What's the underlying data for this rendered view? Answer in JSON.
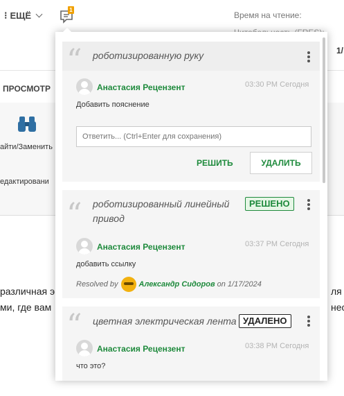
{
  "app": {
    "more_label": "ЕЩЁ",
    "comment_count": "1",
    "reading_time_label": "Время на чтение:",
    "readability_label": "Читабельность (FRES):",
    "right_fragment": "1/",
    "tab_review": "ПРОСМОТР",
    "find_replace_label": "айти/Заменить",
    "edit_label": "едактировани",
    "doc_line1": "различная э",
    "doc_line2": "ми, где вам",
    "doc_line1_right": "ля",
    "doc_line2_right": "нес"
  },
  "comments": [
    {
      "quote": "роботизированную руку",
      "author": "Анастасия Рецензент",
      "time": "03:30 PM Сегодня",
      "text": "Добавить пояснение",
      "reply_placeholder": "Ответить... (Ctrl+Enter для сохранения)",
      "resolve_label": "РЕШИТЬ",
      "delete_label": "УДАЛИТЬ"
    },
    {
      "quote_line1": "роботизированный линейный",
      "quote_line2": "привод",
      "status": "РЕШЕНО",
      "author": "Анастасия Рецензент",
      "time": "03:37 PM Сегодня",
      "text": "добавить ссылку",
      "resolved_by_label": "Resolved by",
      "resolver": "Александр Сидоров",
      "resolved_on": "on 1/17/2024"
    },
    {
      "quote": "цветная электрическая лента",
      "status": "УДАЛЕНО",
      "author": "Анастасия Рецензент",
      "time": "03:38 PM Сегодня",
      "text": "что это?"
    }
  ],
  "colors": {
    "accent_green": "#1e8a3c",
    "badge_orange": "#f0a000"
  }
}
